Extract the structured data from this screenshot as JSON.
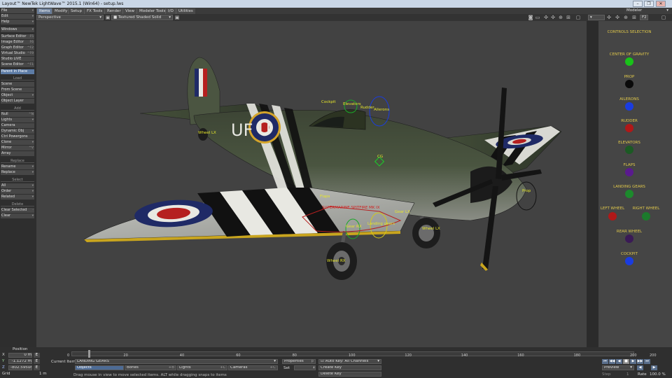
{
  "window": {
    "title": "Layout™ NewTek LightWave™ 2015.1 (Win64) - setup.lws",
    "buttons": [
      "–",
      "❐",
      "✕"
    ]
  },
  "menubar": {
    "tabs": [
      "Items",
      "Modify",
      "Setup",
      "FX Tools",
      "Render",
      "View",
      "Modeler Tools",
      "I/O",
      "Utilities"
    ],
    "active_tab": "Items",
    "modeler": "Modeler"
  },
  "toolbar": {
    "view_mode": "Perspective",
    "shading": "Textured Shaded Solid",
    "right_box": "F2"
  },
  "sidebar": {
    "top": [
      {
        "label": "File",
        "key": "▾"
      },
      {
        "label": "Edit",
        "key": "▾"
      },
      {
        "label": "Help",
        "key": "▾"
      }
    ],
    "windows": {
      "label": "Windows",
      "key": "▾"
    },
    "editors": [
      {
        "label": "Surface Editor",
        "key": "F5"
      },
      {
        "label": "Image Editor",
        "key": "F6"
      },
      {
        "label": "Graph Editor",
        "key": "^F2"
      },
      {
        "label": "Virtual Studio",
        "key": "^F9"
      },
      {
        "label": "Studio LIVE",
        "key": ""
      },
      {
        "label": "Scene Editor",
        "key": "^F1"
      }
    ],
    "parent_in_place": "Parent in Place",
    "load_header": "Load",
    "load": [
      {
        "label": "Scene",
        "key": ""
      },
      {
        "label": "From Scene",
        "key": ""
      },
      {
        "label": "Object",
        "key": "▾"
      },
      {
        "label": "Object Layer",
        "key": ""
      }
    ],
    "add_header": "Add",
    "add": [
      {
        "label": "Null",
        "key": "^N"
      },
      {
        "label": "Lights",
        "key": "▾"
      },
      {
        "label": "Camera",
        "key": ""
      },
      {
        "label": "Dynamic Obj",
        "key": "▾"
      },
      {
        "label": "Ctrl Powergons",
        "key": ""
      },
      {
        "label": "Clone",
        "key": "▾"
      },
      {
        "label": "Mirror",
        "key": "^V"
      },
      {
        "label": "Array",
        "key": ""
      }
    ],
    "replace_header": "Replace",
    "replace": [
      {
        "label": "Rename",
        "key": "▾"
      },
      {
        "label": "Replace",
        "key": "▾"
      }
    ],
    "select_header": "Select",
    "select": [
      {
        "label": "All",
        "key": "▾"
      },
      {
        "label": "Order",
        "key": "▾"
      },
      {
        "label": "Related",
        "key": "▾"
      }
    ],
    "delete_header": "Delete",
    "delete": [
      {
        "label": "Clear Selected",
        "key": "-"
      },
      {
        "label": "Clear",
        "key": "▾"
      }
    ]
  },
  "viewport_labels": {
    "cockpit": "Cockpit",
    "elevators": "Elevators",
    "rudder": "Rudder",
    "ailerons": "Ailerons",
    "wheel_lx_tail": "Wheel LX",
    "cg": "CG",
    "flaps": "Flaps",
    "supermarine": "SUPERMARINE SPITFIRE MK IX",
    "gear_lx": "Gear LX",
    "gear_rx": "Gear RX",
    "landing_gears": "Landing gears",
    "wheel_lx": "Wheel LX",
    "wheel_rx": "Wheel RX",
    "prop": "Prop",
    "fuselage_letters": "UF  U"
  },
  "controls": {
    "title": "CONTROLS SELECTION",
    "items": [
      {
        "label": "CENTER OF GRAVITY",
        "color": "#19c219"
      },
      {
        "label": "PROP",
        "color": "#0a0a0a"
      },
      {
        "label": "AILERONS",
        "color": "#1a3ce0"
      },
      {
        "label": "RUDDER",
        "color": "#b01818"
      },
      {
        "label": "ELEVATORS",
        "color": "#1c5a24"
      },
      {
        "label": "FLAPS",
        "color": "#5a1a8e"
      },
      {
        "label": "LANDING GEARS",
        "color": "#1c8a2c"
      },
      {
        "label": "REAR WHEEL",
        "color": "#3a1a56"
      },
      {
        "label": "COCKPIT",
        "color": "#1a3ce0"
      }
    ],
    "left_wheel": {
      "label": "LEFT WHEEL",
      "color": "#b01818"
    },
    "right_wheel": {
      "label": "RIGHT WHEEL",
      "color": "#1c7a2c"
    }
  },
  "timeline": {
    "position_label": "Position",
    "ticks": [
      "0",
      "20",
      "40",
      "60",
      "80",
      "100",
      "120",
      "140",
      "160",
      "180",
      "200"
    ],
    "end_frame": "200",
    "current_frame": 6
  },
  "bottom": {
    "x_label": "X",
    "x_value": "0 m",
    "y_label": "Y",
    "y_value": "-1.1272 m",
    "z_label": "Z",
    "z_value": "-802.595um",
    "grid_label": "Grid",
    "grid_value": "1 m",
    "e_label": "E",
    "current_item_label": "Current Item",
    "current_item": "LANDING GEARS",
    "objects": "Objects",
    "bones": "Bones",
    "bones_key": "+B",
    "lights": "Lights",
    "lights_key": "+L",
    "cameras": "Cameras",
    "cameras_key": "+C",
    "properties": "Properties",
    "properties_key": "p",
    "set": "Set",
    "set_value": "1",
    "auto_key": "Auto Key: All Channels",
    "create_key": "Create Key",
    "delete_key": "Delete Key",
    "preview": "Preview",
    "step": "Step",
    "step_value": "1",
    "rate": "Rate",
    "rate_value": "100.0 %",
    "status": "Drag mouse in view to move selected items. ALT while dragging snaps to items"
  }
}
